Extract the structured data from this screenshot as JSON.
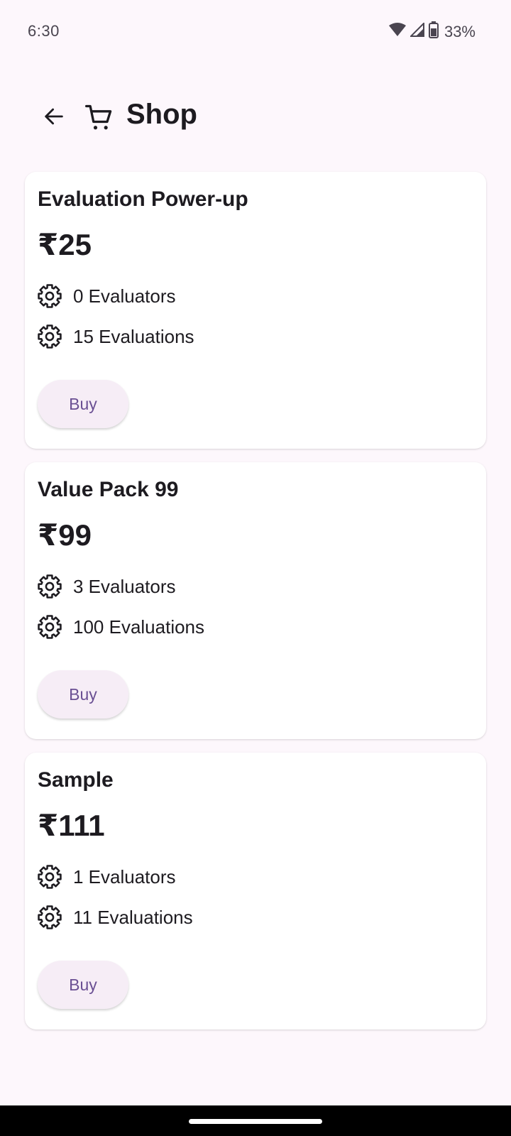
{
  "status_bar": {
    "time": "6:30",
    "battery_percent": "33%"
  },
  "app_bar": {
    "title": "Shop",
    "back_icon": "arrow-back-icon",
    "cart_icon": "cart-icon"
  },
  "products": [
    {
      "title": "Evaluation Power-up",
      "price": "₹25",
      "features": [
        {
          "icon": "gear-icon",
          "text": "0 Evaluators"
        },
        {
          "icon": "gear-icon",
          "text": "15 Evaluations"
        }
      ],
      "buy_label": "Buy"
    },
    {
      "title": "Value Pack 99",
      "price": "₹99",
      "features": [
        {
          "icon": "gear-icon",
          "text": "3 Evaluators"
        },
        {
          "icon": "gear-icon",
          "text": "100 Evaluations"
        }
      ],
      "buy_label": "Buy"
    },
    {
      "title": "Sample",
      "price": "₹111",
      "features": [
        {
          "icon": "gear-icon",
          "text": "1 Evaluators"
        },
        {
          "icon": "gear-icon",
          "text": "11 Evaluations"
        }
      ],
      "buy_label": "Buy"
    }
  ],
  "colors": {
    "background": "#fdf7fc",
    "card": "#ffffff",
    "button_bg": "#f6edf6",
    "button_text": "#6a4f93"
  }
}
